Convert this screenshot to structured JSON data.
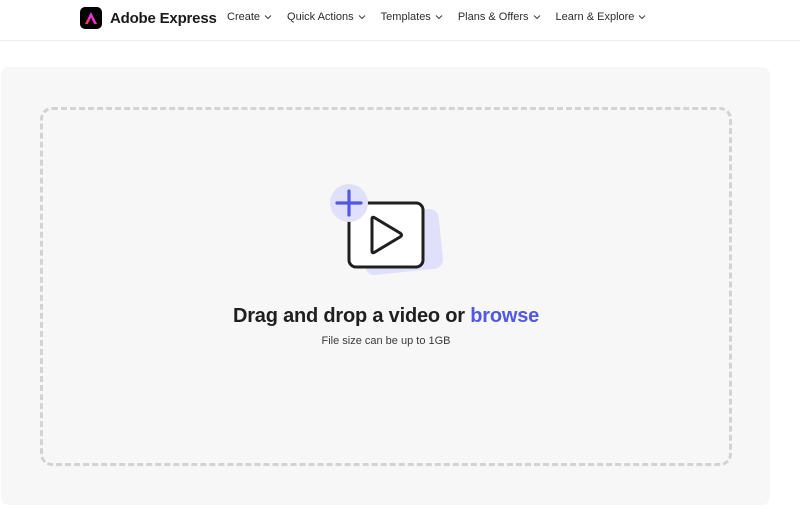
{
  "header": {
    "brand_name": "Adobe Express",
    "nav": [
      {
        "label": "Create"
      },
      {
        "label": "Quick Actions"
      },
      {
        "label": "Templates"
      },
      {
        "label": "Plans & Offers"
      },
      {
        "label": "Learn & Explore"
      }
    ]
  },
  "upload": {
    "headline_prefix": "Drag and drop a video or ",
    "browse_label": "browse",
    "file_limit_text": "File size can be up to 1GB"
  },
  "icons": {
    "brand": "adobe-express-logo-icon",
    "nav_chevron": "chevron-down-icon",
    "add": "plus-icon",
    "video": "video-play-icon"
  },
  "colors": {
    "accent": "#5258e4",
    "accent_light": "#e0e0fb",
    "panel_bg": "#f7f7f7",
    "dash_border": "#d3d3d3"
  }
}
